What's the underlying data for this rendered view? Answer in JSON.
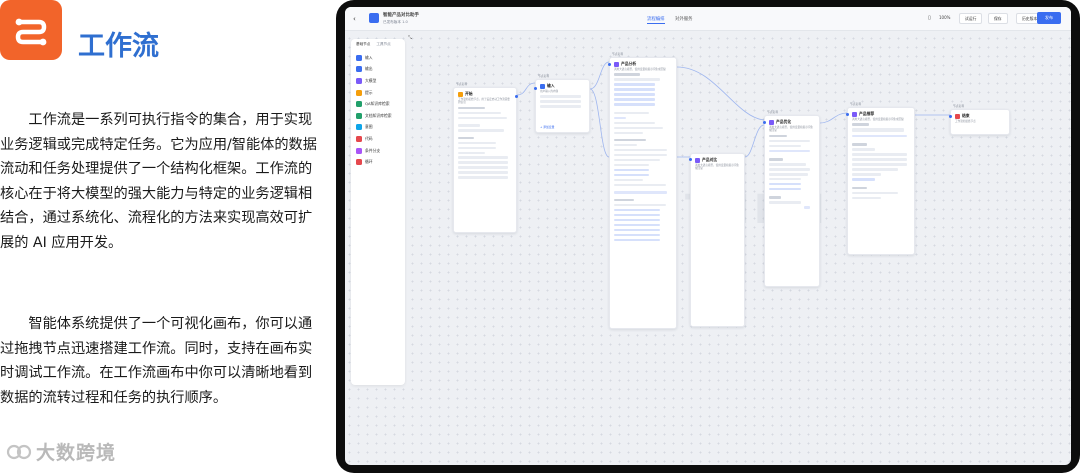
{
  "slide": {
    "title": "工作流",
    "paragraph1": "工作流是一系列可执行指令的集合，用于实现业务逻辑或完成特定任务。它为应用/智能体的数据流动和任务处理提供了一个结构化框架。工作流的核心在于将大模型的强大能力与特定的业务逻辑相结合，通过系统化、流程化的方法来实现高效可扩展的 AI 应用开发。",
    "paragraph2": "智能体系统提供了一个可视化画布，你可以通过拖拽节点迅速搭建工作流。同时，支持在画布实时调试工作流。在工作流画布中你可以清晰地看到数据的流转过程和任务的执行顺序。",
    "watermark": "大数跨境",
    "logo_color": "#f2642a",
    "title_color": "#2f6fd0"
  },
  "app": {
    "workflow_name": "智能产品对比助手",
    "workflow_sub": "已发布版本 1.0",
    "tabs": [
      "流程编排",
      "对外服务"
    ],
    "active_tab": "流程编排",
    "zoom": "100%",
    "buttons": {
      "run": "试运行",
      "save": "保存",
      "history": "历史版本",
      "publish": "发布"
    },
    "accent": "#3a6df0"
  },
  "panel": {
    "tabs": [
      "基础节点",
      "工具节点"
    ],
    "items": [
      {
        "label": "输入",
        "color": "#3a6df0"
      },
      {
        "label": "输出",
        "color": "#3a6df0"
      },
      {
        "label": "大模型",
        "color": "#7a5af8"
      },
      {
        "label": "提示",
        "color": "#f59e0b"
      },
      {
        "label": "QA知识库检索",
        "color": "#22a06b"
      },
      {
        "label": "文档知识库检索",
        "color": "#22a06b"
      },
      {
        "label": "意图",
        "color": "#0ea5e9"
      },
      {
        "label": "代码",
        "color": "#e5484d"
      },
      {
        "label": "条件分支",
        "color": "#a855f7"
      },
      {
        "label": "循环",
        "color": "#e5484d"
      }
    ]
  },
  "nodes": {
    "start": {
      "title": "开始",
      "color": "#f59e0b",
      "desc": "工作流的起始节点，用于设定启动工作流需要的信息",
      "link": "查看变量"
    },
    "input": {
      "title": "输入",
      "color": "#3a6df0",
      "desc": "用户输入的内容",
      "link": "+ 添加变量"
    },
    "llm1": {
      "title": "产品分析",
      "color": "#7a5af8",
      "desc": "调用大语言模型，使用变量和提示词生成回复"
    },
    "llm2": {
      "title": "产品对比",
      "color": "#7a5af8",
      "desc": "调用大语言模型，使用变量和提示词生成回复"
    },
    "llm3": {
      "title": "产品优化",
      "color": "#7a5af8",
      "desc": "调用大语言模型，使用变量和提示词生成回复"
    },
    "llm4": {
      "title": "产品推荐",
      "color": "#7a5af8",
      "desc": "调用大语言模型，使用变量和提示词生成回复"
    },
    "end": {
      "title": "结束",
      "color": "#e5484d",
      "desc": "工作流的最终节点"
    },
    "model_name": "gpt-4o-mini"
  }
}
